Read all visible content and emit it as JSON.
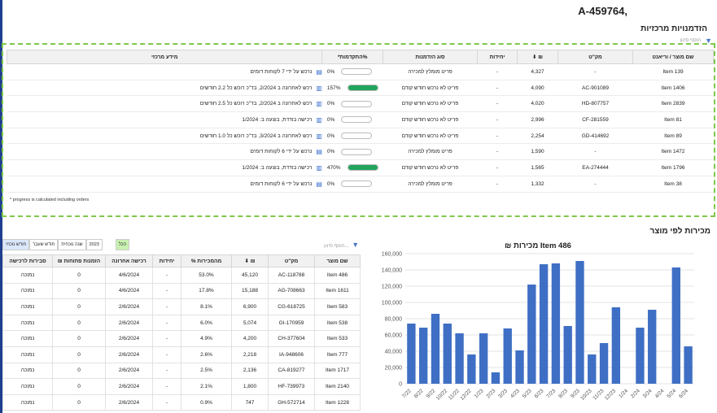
{
  "account_id": "A-459764,",
  "section_opportunities": "הזדמנויות מרכזיות",
  "filter_label": "הוסף סינון",
  "opp_table": {
    "headers": [
      "שם מוצר / וריאנט",
      "מק\"ט",
      "₪ ⬇",
      "יחידות",
      "סוג הזדמנות",
      "%התקדמות*",
      "מידע מרכזי"
    ],
    "rows": [
      {
        "name": "Item 139",
        "sku": "-",
        "value": "4,327",
        "units": "-",
        "type": "פריט מומלץ למכירה",
        "progress": "0%",
        "progress_pct": 0,
        "info": "נרכש על ידי 7 לקוחות דומים",
        "icon": "table-icon"
      },
      {
        "name": "Item 1406",
        "sku": "AC-901089",
        "value": "4,090",
        "units": "-",
        "type": "פריט לא נרכש חודש קודם",
        "progress": "157%",
        "progress_pct": 100,
        "info": "רכש לאחרונה ב 2/2024, בד\"כ רוכש כל 2.2 חודשים",
        "icon": "bar-chart-icon"
      },
      {
        "name": "Item 2839",
        "sku": "HD-807757",
        "value": "4,020",
        "units": "-",
        "type": "פריט לא נרכש חודש קודם",
        "progress": "0%",
        "progress_pct": 0,
        "info": "רכש לאחרונה ב 2/2024, בד\"כ רוכש כל 2.5 חודשים",
        "icon": "bar-chart-icon"
      },
      {
        "name": "Item 81",
        "sku": "CF-281559",
        "value": "2,996",
        "units": "-",
        "type": "פריט לא נרכש חודש קודם",
        "progress": "0%",
        "progress_pct": 0,
        "info": "רכישה בודדת, בוצעה ב: 1/2024",
        "icon": "bar-chart-icon"
      },
      {
        "name": "Item 89",
        "sku": "GD-414692",
        "value": "2,254",
        "units": "-",
        "type": "פריט לא נרכש חודש קודם",
        "progress": "0%",
        "progress_pct": 0,
        "info": "רכש לאחרונה ב 3/2024, בד\"כ רוכש כל 1.0 חודשים",
        "icon": "bar-chart-icon"
      },
      {
        "name": "Item 1472",
        "sku": "-",
        "value": "1,590",
        "units": "-",
        "type": "פריט מומלץ למכירה",
        "progress": "0%",
        "progress_pct": 0,
        "info": "נרכש על ידי 6 לקוחות דומים",
        "icon": "table-icon"
      },
      {
        "name": "Item 1796",
        "sku": "EA-274444",
        "value": "1,565",
        "units": "-",
        "type": "פריט לא נרכש חודש קודם",
        "progress": "470%",
        "progress_pct": 100,
        "info": "רכישה בודדת, בוצעה ב: 1/2024",
        "icon": "bar-chart-icon"
      },
      {
        "name": "Item 38",
        "sku": "-",
        "value": "1,332",
        "units": "-",
        "type": "פריט מומלץ למכירה",
        "progress": "0%",
        "progress_pct": 0,
        "info": "נרכש על ידי 6 לקוחות דומים",
        "icon": "table-icon"
      }
    ]
  },
  "footnote": "* progress is calculated including orders",
  "section_sales": "מכירות לפי מוצר",
  "period_tabs": [
    "חודש נוכחי",
    "חודש שעבר",
    "שנה נוכחית",
    "2023",
    "הכל"
  ],
  "sales_filter_label": "הוסף סינון...",
  "sales_table": {
    "headers": [
      "שם מוצר",
      "מק\"ט",
      "₪ ⬇",
      "מהמכירות %",
      "יחידות",
      "רכישה אחרונה",
      "הזמנות פתוחות ₪",
      "סבירות לרכישה"
    ],
    "rows": [
      [
        "Item 486",
        "AC-118788",
        "45,120",
        "53.0%",
        "-",
        "4/6/2024",
        "0",
        "נמוכה"
      ],
      [
        "Item 1611",
        "AG-708663",
        "15,188",
        "17.8%",
        "-",
        "4/6/2024",
        "0",
        "נמוכה"
      ],
      [
        "Item 583",
        "CG-618725",
        "6,900",
        "8.1%",
        "-",
        "2/6/2024",
        "0",
        "נמוכה"
      ],
      [
        "Item 538",
        "GI-170959",
        "5,074",
        "6.0%",
        "-",
        "2/6/2024",
        "0",
        "נמוכה"
      ],
      [
        "Item 533",
        "CH-377604",
        "4,200",
        "4.9%",
        "-",
        "2/6/2024",
        "0",
        "נמוכה"
      ],
      [
        "Item 777",
        "IA-948606",
        "2,218",
        "2.6%",
        "-",
        "2/6/2024",
        "0",
        "נמוכה"
      ],
      [
        "Item 1717",
        "CA-819277",
        "2,136",
        "2.5%",
        "-",
        "2/6/2024",
        "0",
        "נמוכה"
      ],
      [
        "Item 2140",
        "HF-739973",
        "1,800",
        "2.1%",
        "-",
        "2/6/2024",
        "0",
        "נמוכה"
      ],
      [
        "Item 1228",
        "GH-572714",
        "747",
        "0.9%",
        "-",
        "2/6/2024",
        "0",
        "נמוכה"
      ]
    ]
  },
  "colors": {
    "accent": "#3f6fc4",
    "progress_green": "#22a45d",
    "dash_green": "#7ec84a"
  },
  "chart_data": {
    "type": "bar",
    "title": "Item 486 מכירות ₪",
    "categories": [
      "7/22",
      "8/22",
      "9/22",
      "10/22",
      "11/22",
      "12/22",
      "1/23",
      "2/23",
      "3/23",
      "4/23",
      "5/23",
      "6/23",
      "7/23",
      "8/23",
      "9/23",
      "10/23",
      "11/23",
      "12/23",
      "1/24",
      "2/24",
      "3/24",
      "4/24",
      "5/24",
      "6/24"
    ],
    "values": [
      74000,
      69000,
      86000,
      74000,
      62000,
      36000,
      62000,
      14000,
      68000,
      41000,
      122000,
      147000,
      148000,
      71000,
      151000,
      36000,
      50000,
      94000,
      0,
      69000,
      91000,
      0,
      143000,
      46000
    ],
    "ylim": [
      0,
      160000
    ],
    "yticks": [
      "0",
      "20,000",
      "40,000",
      "60,000",
      "80,000",
      "100,000",
      "120,000",
      "140,000",
      "160,000"
    ],
    "grid": true,
    "color": "#3f6fc4"
  }
}
